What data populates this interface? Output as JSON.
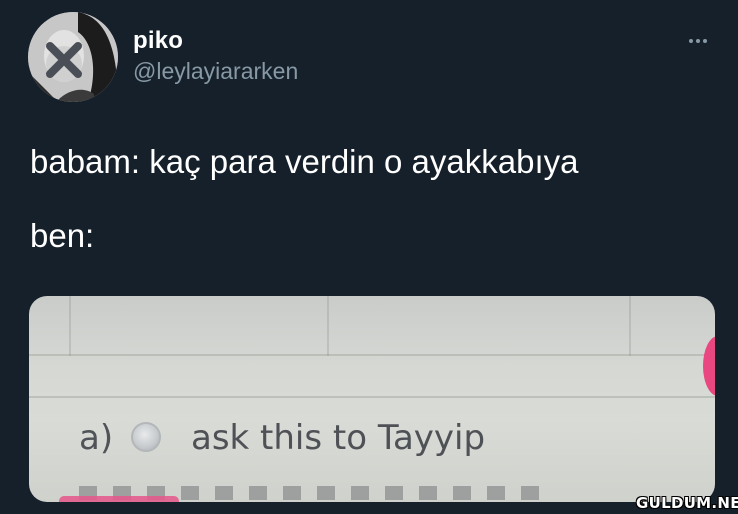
{
  "author": {
    "name": "piko",
    "handle": "@leylayiararken"
  },
  "menu": {
    "icon": "more-horizontal-icon"
  },
  "tweet": {
    "lines": [
      "babam: kaç para verdin o ayakkabıya",
      "ben:"
    ]
  },
  "media": {
    "option_label": "a)",
    "option_text": "ask this to Tayyip"
  },
  "watermark": "GULDUM.NET",
  "colors": {
    "background": "#15202b",
    "text": "#ffffff",
    "secondary_text": "#8899a6"
  }
}
